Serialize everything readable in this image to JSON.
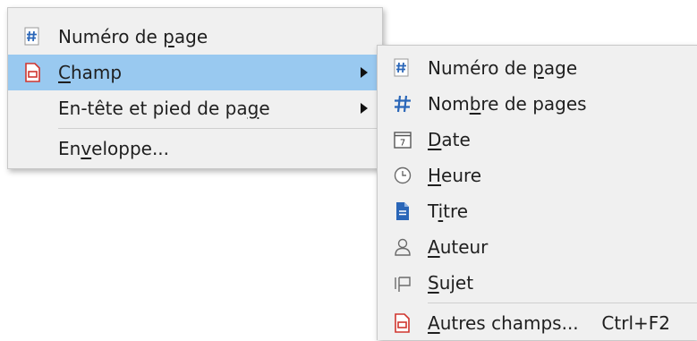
{
  "main_menu": {
    "items": [
      {
        "id": "page-number",
        "pre": "Numéro de ",
        "acc": "p",
        "post": "age",
        "icon": "page-number-icon"
      },
      {
        "id": "field",
        "pre": "",
        "acc": "C",
        "post": "hamp",
        "icon": "field-icon",
        "submenu": true,
        "highlighted": true
      },
      {
        "id": "header-footer",
        "pre": "En-tête et pied de pa",
        "acc": "g",
        "post": "e",
        "submenu": true
      },
      {
        "id": "envelope",
        "pre": "En",
        "acc": "v",
        "post": "eloppe...",
        "separator_before": true
      }
    ]
  },
  "sub_menu": {
    "items": [
      {
        "id": "page-number",
        "pre": "Numéro de ",
        "acc": "p",
        "post": "age",
        "icon": "page-number-icon"
      },
      {
        "id": "page-count",
        "pre": "Nom",
        "acc": "b",
        "post": "re de pages",
        "icon": "page-count-icon"
      },
      {
        "id": "date",
        "pre": "",
        "acc": "D",
        "post": "ate",
        "icon": "calendar-icon",
        "icon_text": "7"
      },
      {
        "id": "time",
        "pre": "",
        "acc": "H",
        "post": "eure",
        "icon": "clock-icon"
      },
      {
        "id": "title",
        "pre": "T",
        "acc": "i",
        "post": "tre",
        "icon": "document-title-icon"
      },
      {
        "id": "author",
        "pre": "",
        "acc": "A",
        "post": "uteur",
        "icon": "person-icon"
      },
      {
        "id": "subject",
        "pre": "",
        "acc": "S",
        "post": "ujet",
        "icon": "subject-icon"
      },
      {
        "id": "more-fields",
        "pre": "",
        "acc": "A",
        "post": "utres champs...",
        "shortcut": "Ctrl+F2",
        "icon": "field-icon",
        "separator_before": true
      }
    ]
  },
  "colors": {
    "highlight": "#99c9f0",
    "menu_bg": "#f0f0f0",
    "icon_blue": "#2a66b8",
    "icon_red": "#d0362f",
    "icon_gray": "#6b6b6b"
  }
}
